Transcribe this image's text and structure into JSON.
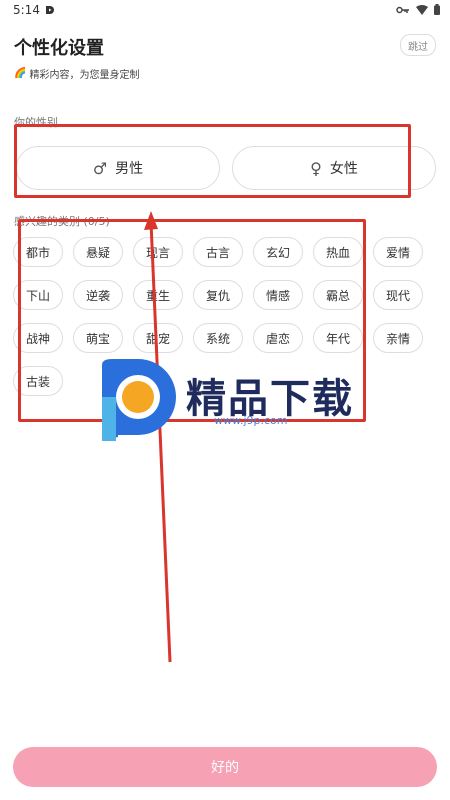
{
  "status_bar": {
    "time": "5:14"
  },
  "header": {
    "title": "个性化设置",
    "skip_label": "跳过"
  },
  "subtitle": {
    "icon": "rainbow-icon",
    "text": "精彩内容，为您量身定制"
  },
  "gender": {
    "label": "你的性别",
    "options": [
      {
        "symbol": "♂",
        "label": "男性"
      },
      {
        "symbol": "♀",
        "label": "女性"
      }
    ]
  },
  "categories": {
    "label": "感兴趣的类别 (0/5)",
    "tags": [
      "都市",
      "悬疑",
      "现言",
      "古言",
      "玄幻",
      "热血",
      "爱情",
      "下山",
      "逆袭",
      "重生",
      "复仇",
      "情感",
      "霸总",
      "现代",
      "战神",
      "萌宝",
      "甜宠",
      "系统",
      "虐恋",
      "年代",
      "亲情",
      "古装"
    ]
  },
  "watermark": {
    "text": "精品下载",
    "url": "www.j9p.com"
  },
  "footer": {
    "ok_label": "好的"
  },
  "colors": {
    "accent_button": "#f7a1b5",
    "annotation_red": "#d9352c"
  }
}
